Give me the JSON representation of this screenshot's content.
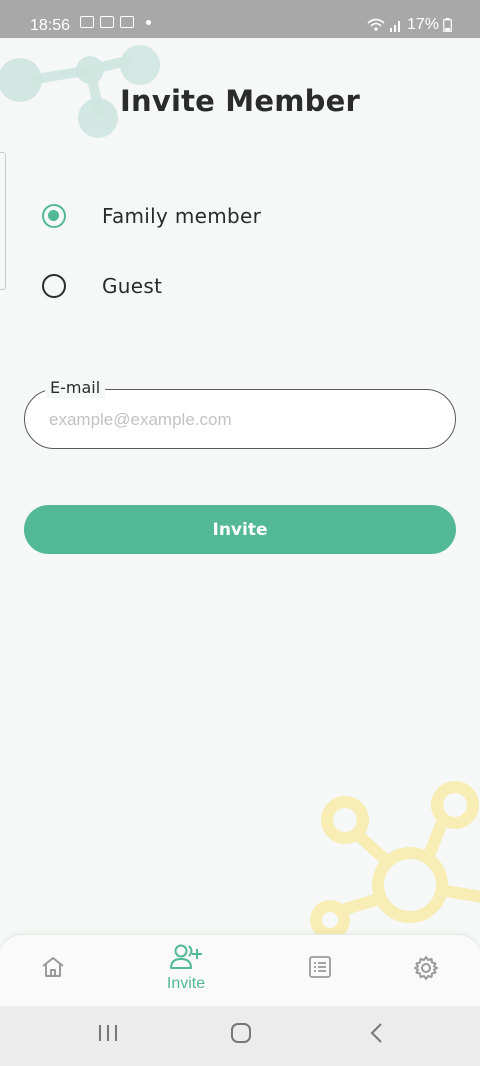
{
  "status_bar": {
    "time": "18:56",
    "battery": "17%",
    "icons_left": [
      "screenshot-icon",
      "screenshot-icon",
      "image-icon",
      "dot-icon"
    ],
    "icons_right": [
      "wifi-icon",
      "signal-icon",
      "battery-icon"
    ]
  },
  "page": {
    "title": "Invite Member"
  },
  "member_type": {
    "options": [
      {
        "label": "Family member",
        "selected": true
      },
      {
        "label": "Guest",
        "selected": false
      }
    ]
  },
  "email": {
    "label": "E-mail",
    "value": "",
    "placeholder": "example@example.com"
  },
  "actions": {
    "invite_label": "Invite"
  },
  "bottom_nav": {
    "items": [
      {
        "icon": "home-icon",
        "label": "",
        "active": false
      },
      {
        "icon": "add-user-icon",
        "label": "Invite",
        "active": true
      },
      {
        "icon": "list-icon",
        "label": "",
        "active": false
      },
      {
        "icon": "gear-icon",
        "label": "",
        "active": false
      }
    ]
  },
  "colors": {
    "accent": "#52b896",
    "background": "#f6f8f7",
    "inactive_icon": "#9a9a9a",
    "decoration_top": "#cfe6df",
    "decoration_bottom": "#f7edb5"
  }
}
